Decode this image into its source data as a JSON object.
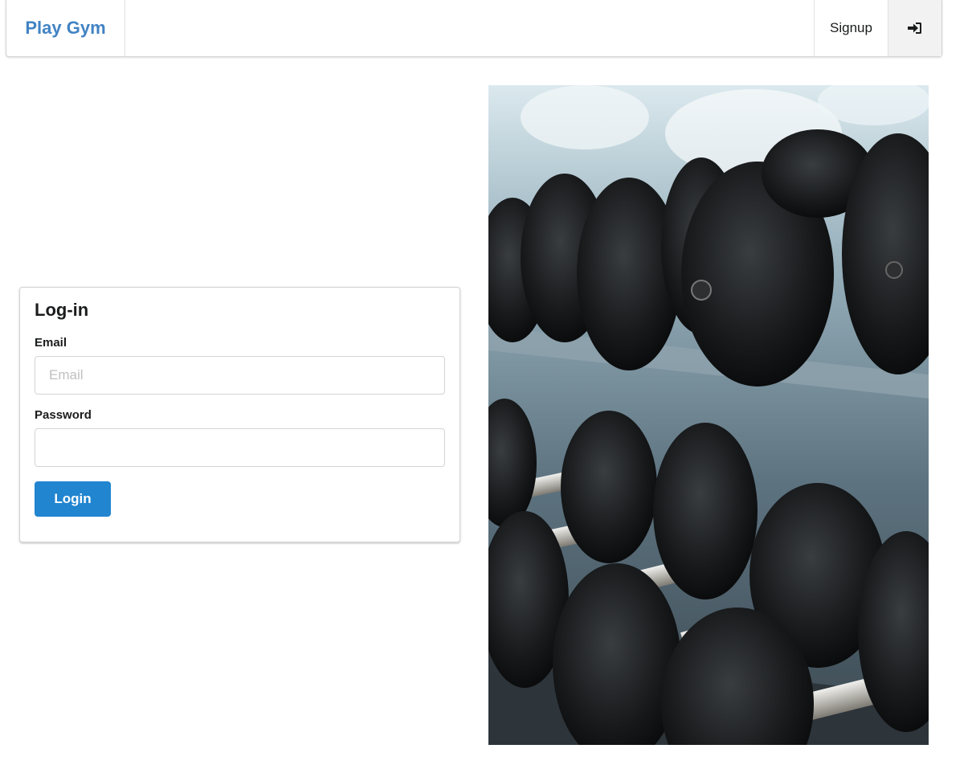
{
  "header": {
    "brand": "Play Gym",
    "signup_label": "Signup",
    "login_icon": "sign-in-icon"
  },
  "login_form": {
    "title": "Log-in",
    "email_label": "Email",
    "email_placeholder": "Email",
    "email_value": "",
    "password_label": "Password",
    "password_value": "",
    "submit_label": "Login"
  },
  "hero_image": {
    "subject": "gym-dumbbell-rack-photo"
  },
  "colors": {
    "brand": "#4183c4",
    "primary_button": "#2185d0"
  }
}
